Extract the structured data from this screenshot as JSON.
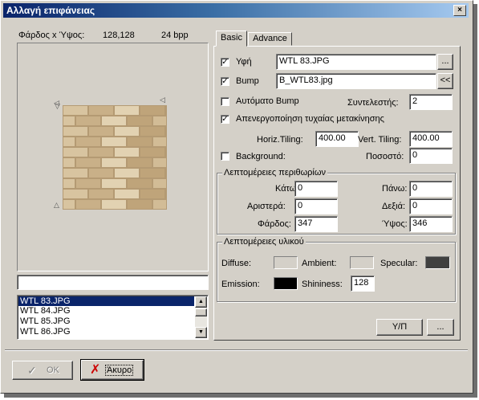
{
  "window": {
    "title": "Αλλαγή επιφάνειας",
    "close_glyph": "×"
  },
  "preview": {
    "dimensions_label": "Φάρδος x Ύψος:",
    "dimensions_value": "128,128",
    "bpp": "24 bpp"
  },
  "path_input": {
    "value": ""
  },
  "file_list": {
    "items": [
      "WTL 83.JPG",
      "WTL 84.JPG",
      "WTL 85.JPG",
      "WTL 86.JPG"
    ],
    "selected_index": 0
  },
  "tabs": [
    {
      "label": "Basic",
      "active": true
    },
    {
      "label": "Advance",
      "active": false
    }
  ],
  "texture": {
    "label": "Υφή",
    "checked": true,
    "value": "WTL 83.JPG",
    "browse": "..."
  },
  "bump": {
    "label": "Bump",
    "checked": true,
    "value": "B_WTL83.jpg",
    "copy": "<<"
  },
  "auto_bump": {
    "label": "Αυτόματο Bump",
    "checked": false,
    "coef_label": "Συντελεστής:",
    "coef_value": "2"
  },
  "random_offset": {
    "label": "Απενεργοποίηση τυχαίας μετακίνησης",
    "checked": true
  },
  "tiling": {
    "h_label": "Horiz.Tiling:",
    "h_value": "400.00",
    "v_label": "Vert. Tiling:",
    "v_value": "400.00"
  },
  "background": {
    "label": "Background:",
    "checked": false,
    "pct_label": "Ποσοστό:",
    "pct_value": "0"
  },
  "margins": {
    "title": "Λεπτομέρειες περιθωρίων",
    "bottom_label": "Κάτω:",
    "bottom_value": "0",
    "top_label": "Πάνω:",
    "top_value": "0",
    "left_label": "Αριστερά:",
    "left_value": "0",
    "right_label": "Δεξιά:",
    "right_value": "0",
    "width_label": "Φάρδος:",
    "width_value": "347",
    "height_label": "Ύψος:",
    "height_value": "346"
  },
  "material": {
    "title": "Λεπτομέρειες υλικού",
    "diffuse_label": "Diffuse:",
    "diffuse_color": "#d4d0c8",
    "ambient_label": "Ambient:",
    "ambient_color": "#d4d0c8",
    "specular_label": "Specular:",
    "specular_color": "#404040",
    "emission_label": "Emission:",
    "emission_color": "#000000",
    "shininess_label": "Shininess:",
    "shininess_value": "128"
  },
  "buttons": {
    "yp": "Υ/Π",
    "more": "...",
    "ok": "OK",
    "cancel": "Άκυρο"
  },
  "colors": {
    "title_start": "#0a246a",
    "title_end": "#a6caf0",
    "face": "#d4d0c8",
    "selection": "#0a246a"
  },
  "icons": {
    "ok": "check-icon",
    "cancel": "x-icon"
  }
}
